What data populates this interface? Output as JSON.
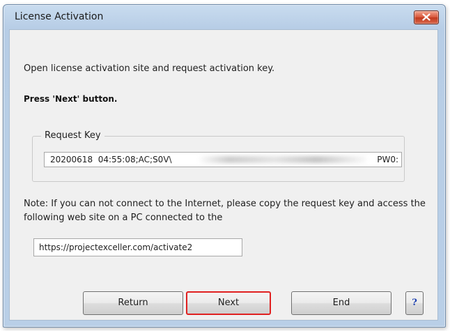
{
  "window": {
    "title": "License Activation",
    "close_icon": "close-x-icon",
    "close_color": "#d9583d"
  },
  "instructions": {
    "line1": "Open license activation site and request activation key.",
    "line2": "Press 'Next' button."
  },
  "request_key": {
    "label": "Request Key",
    "value_start": "20200618  04:55:08;AC;S0V\\",
    "value_end": "PW0:"
  },
  "note": {
    "text": "Note: If you can not connect to the Internet, please copy the request key and access the following web site on a PC connected to the"
  },
  "url": {
    "value": "https://projectexceller.com/activate2"
  },
  "buttons": {
    "return_label": "Return",
    "next_label": "Next",
    "end_label": "End",
    "help_label": "?",
    "next_highlight_color": "#e02020"
  }
}
